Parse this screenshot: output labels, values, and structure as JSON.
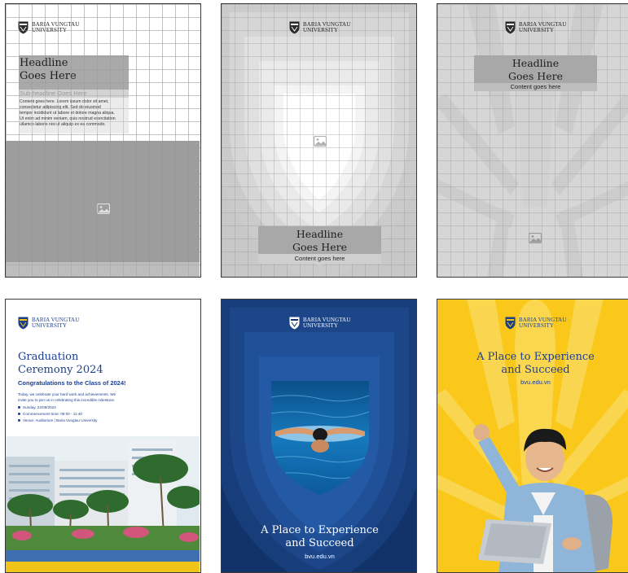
{
  "logo": {
    "line1": "BARIA VUNGTAU",
    "line2": "UNIVERSITY"
  },
  "card1": {
    "headline1": "Headline",
    "headline2": "Goes Here",
    "subheadline": "Sub-headline Goes Here",
    "body": [
      "Content goes here. Lorem ipsum dolor sit amet,",
      "consectetur adipiscing elit. Sed do eiusmod",
      "tempor incididunt ut labore et dolore magna aliqua.",
      "Ut enim ad minim veniam, quis nostrud exercitation",
      "ullamco laboris nisi ut aliquip ex ea commodo."
    ]
  },
  "card2": {
    "headline1": "Headline",
    "headline2": "Goes Here",
    "content": "Content goes here"
  },
  "card3": {
    "headline1": "Headline",
    "headline2": "Goes Here",
    "content": "Content goes here"
  },
  "card4": {
    "title1": "Graduation",
    "title2": "Ceremony 2024",
    "subtitle": "Congratulations to the Class of 2024!",
    "intro": [
      "Today, we celebrate your hard work and achievements. We",
      "invite you to join us in celebrating this incredible milestone."
    ],
    "details": [
      "Sunday, 22/09/2024",
      "Commencement time: 09:00 - 11:40",
      "Venue: Auditorium | Baria Vungtau University"
    ]
  },
  "card5": {
    "title1": "A Place to Experience",
    "title2": "and Succeed",
    "url": "bvu.edu.vn"
  },
  "card6": {
    "title1": "A Place to Experience",
    "title2": "and Succeed",
    "url": "bvu.edu.vn"
  },
  "colors": {
    "brand_navy": "#12336a",
    "brand_yellow": "#f9c81a",
    "text_blue": "#1d3f8f"
  }
}
